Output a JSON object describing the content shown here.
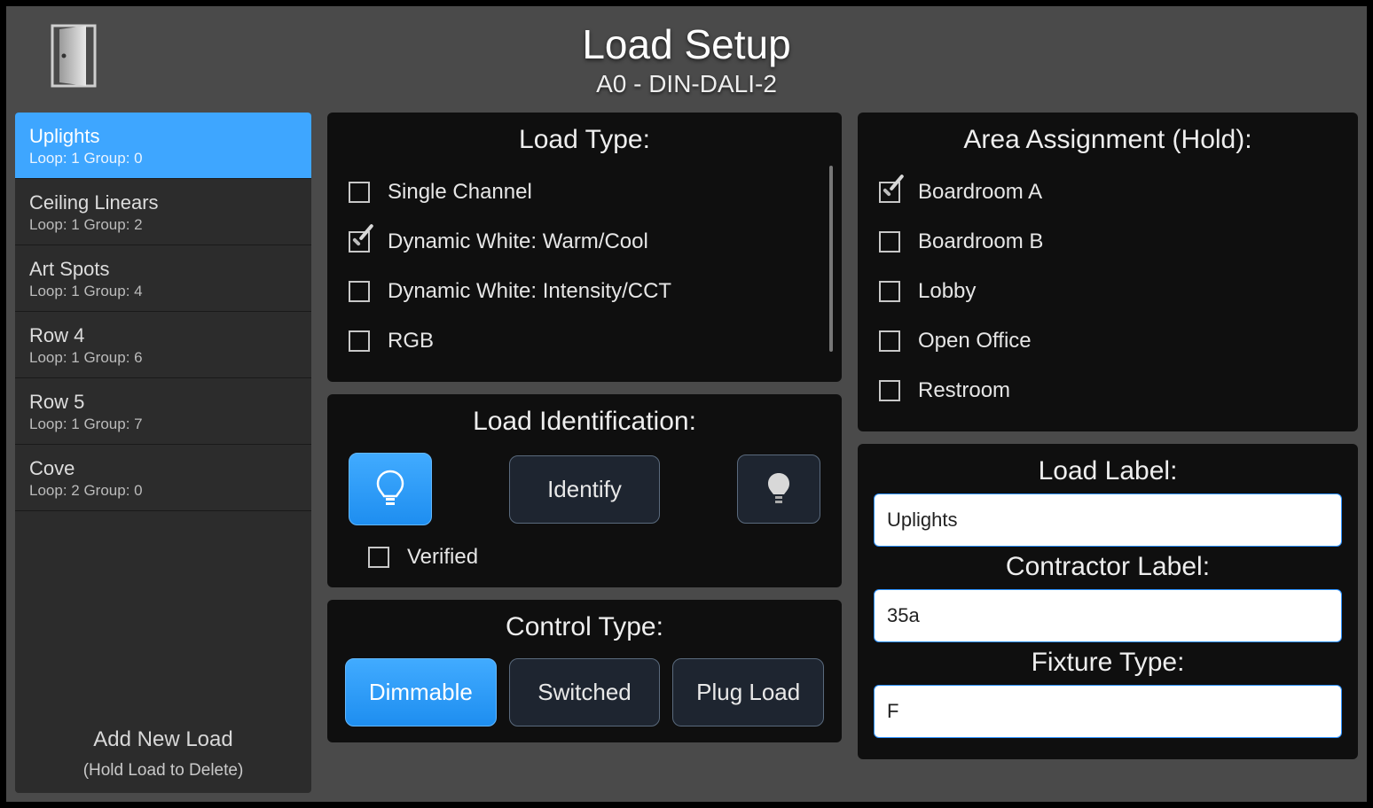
{
  "header": {
    "title": "Load Setup",
    "subtitle": "A0 - DIN-DALI-2"
  },
  "sidebar": {
    "loads": [
      {
        "name": "Uplights",
        "meta": "Loop: 1 Group: 0",
        "selected": true
      },
      {
        "name": "Ceiling Linears",
        "meta": "Loop: 1 Group: 2",
        "selected": false
      },
      {
        "name": "Art Spots",
        "meta": "Loop: 1 Group: 4",
        "selected": false
      },
      {
        "name": "Row 4",
        "meta": "Loop: 1 Group: 6",
        "selected": false
      },
      {
        "name": "Row 5",
        "meta": "Loop: 1 Group: 7",
        "selected": false
      },
      {
        "name": "Cove",
        "meta": "Loop: 2 Group: 0",
        "selected": false
      }
    ],
    "add_label": "Add New Load",
    "delete_hint": "(Hold Load to Delete)"
  },
  "load_type": {
    "title": "Load Type:",
    "options": [
      {
        "label": "Single Channel",
        "checked": false
      },
      {
        "label": "Dynamic White: Warm/Cool",
        "checked": true
      },
      {
        "label": "Dynamic White: Intensity/CCT",
        "checked": false
      },
      {
        "label": "RGB",
        "checked": false
      }
    ]
  },
  "identification": {
    "title": "Load Identification:",
    "identify_label": "Identify",
    "verified_label": "Verified",
    "verified_checked": false
  },
  "control_type": {
    "title": "Control Type:",
    "options": [
      {
        "label": "Dimmable",
        "active": true
      },
      {
        "label": "Switched",
        "active": false
      },
      {
        "label": "Plug Load",
        "active": false
      }
    ]
  },
  "area": {
    "title": "Area Assignment (Hold):",
    "options": [
      {
        "label": "Boardroom A",
        "checked": true
      },
      {
        "label": "Boardroom B",
        "checked": false
      },
      {
        "label": "Lobby",
        "checked": false
      },
      {
        "label": "Open Office",
        "checked": false
      },
      {
        "label": "Restroom",
        "checked": false
      }
    ]
  },
  "labels": {
    "load_label_title": "Load Label:",
    "load_label_value": "Uplights",
    "contractor_label_title": "Contractor Label:",
    "contractor_label_value": "35a",
    "fixture_type_title": "Fixture Type:",
    "fixture_type_value": "F"
  },
  "colors": {
    "accent_blue": "#3ea6ff",
    "panel_bg": "#0f0f0f",
    "app_bg": "#4a4a4a"
  }
}
